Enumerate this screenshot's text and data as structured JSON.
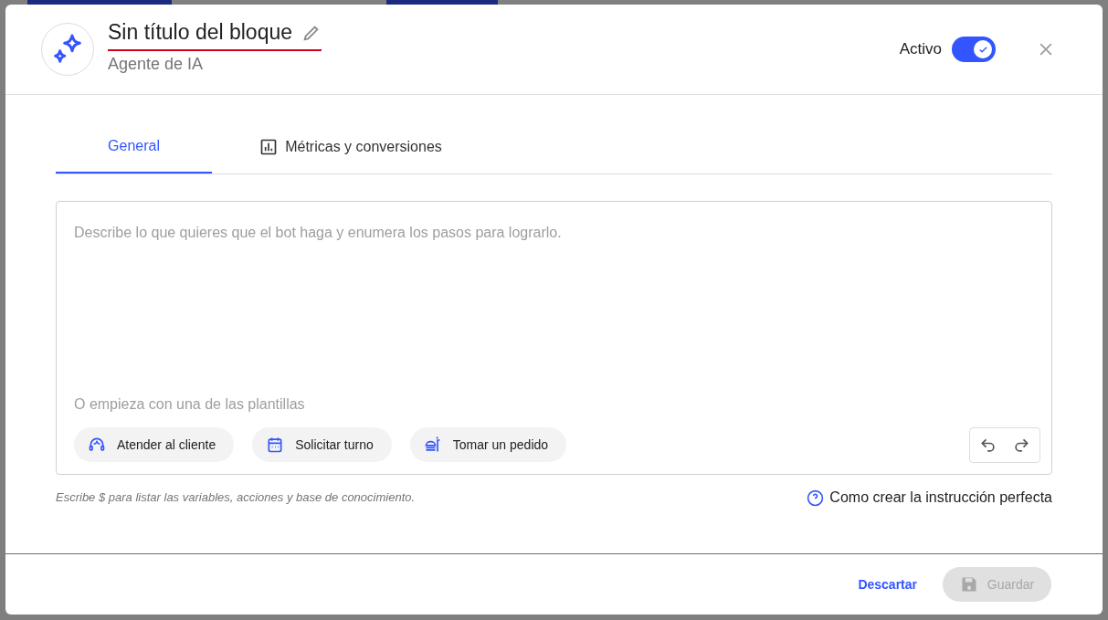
{
  "header": {
    "title": "Sin título del bloque",
    "subtitle": "Agente de IA",
    "active_label": "Activo",
    "active": {
      "on": true
    }
  },
  "tabs": [
    {
      "label": "General",
      "selected": true,
      "kind": "plain"
    },
    {
      "label": "Métricas y conversiones",
      "selected": false,
      "kind": "chart"
    }
  ],
  "editor": {
    "placeholder": "Describe lo que quieres que el bot haga y enumera los pasos para lograrlo.",
    "templates_label": "O empieza con una de las plantillas",
    "templates": [
      {
        "label": "Atender al cliente",
        "kind": "support"
      },
      {
        "label": "Solicitar turno",
        "kind": "calendar"
      },
      {
        "label": "Tomar un pedido",
        "kind": "food"
      }
    ]
  },
  "hint": "Escribe $ para listar las variables, acciones y base de conocimiento.",
  "help_link": "Como crear la instrucción perfecta",
  "footer": {
    "discard": "Descartar",
    "save": {
      "label": "Guardar",
      "disabled": true
    }
  }
}
